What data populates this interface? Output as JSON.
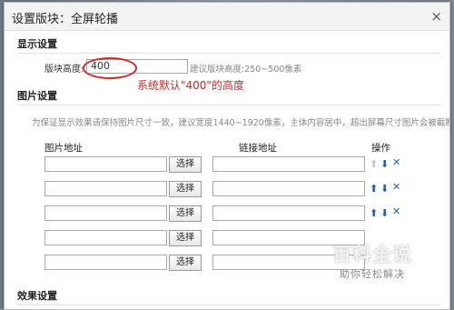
{
  "dialog": {
    "title": "设置版块：全屏轮播",
    "close_icon": "×"
  },
  "display": {
    "section_title": "显示设置",
    "height_label": "版块高度:",
    "height_value": "400",
    "height_hint": "建议版块高度:250~500像素",
    "annotation": "系统默认\"400\"的高度"
  },
  "images": {
    "section_title": "图片设置",
    "hint": "为保证显示效果请保持图片尺寸一致，建议宽度1440~1920像素，主体内容居中，超出屏幕尺寸图片会被截断",
    "columns": {
      "image": "图片地址",
      "link": "链接地址",
      "ops": "操作"
    },
    "choose_label": "选择",
    "rows": [
      {
        "up": "disabled",
        "down": true,
        "delete": true
      },
      {
        "up": true,
        "down": true,
        "delete": true
      },
      {
        "up": true,
        "down": true,
        "delete": true
      },
      {
        "up": false,
        "down": false,
        "delete": false
      },
      {
        "up": false,
        "down": false,
        "delete": false
      }
    ]
  },
  "effects": {
    "section_title": "效果设置"
  },
  "watermark": {
    "title": "百科全说",
    "subtitle": "助你轻松解决"
  },
  "colors": {
    "annotation": "#c62a2a",
    "icon": "#1f5fa6"
  }
}
